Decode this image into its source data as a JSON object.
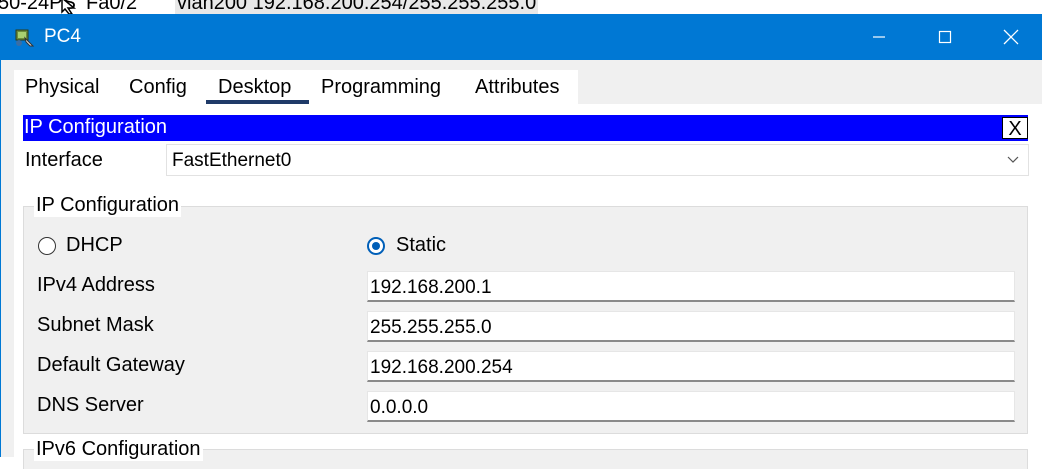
{
  "background": {
    "left_text": "50-24PS",
    "port_text": "Fa0/2",
    "vlan_text": "vlan200 192.168.200.254/255.255.255.0"
  },
  "window": {
    "title": "PC4",
    "icon": "pc-icon",
    "controls": {
      "minimize": "minimize-icon",
      "maximize": "maximize-icon",
      "close": "close-icon"
    }
  },
  "tabs": [
    {
      "label": "Physical"
    },
    {
      "label": "Config"
    },
    {
      "label": "Desktop",
      "active": true
    },
    {
      "label": "Programming"
    },
    {
      "label": "Attributes"
    }
  ],
  "ip_config": {
    "header_title": "IP Configuration",
    "close_label": "X",
    "interface_label": "Interface",
    "interface_value": "FastEthernet0",
    "group_title": "IP Configuration",
    "dhcp_label": "DHCP",
    "static_label": "Static",
    "mode_selected": "Static",
    "fields": [
      {
        "label": "IPv4 Address",
        "value": "192.168.200.1"
      },
      {
        "label": "Subnet Mask",
        "value": "255.255.255.0"
      },
      {
        "label": "Default Gateway",
        "value": "192.168.200.254"
      },
      {
        "label": "DNS Server",
        "value": "0.0.0.0"
      }
    ],
    "ipv6_group_title": "IPv6 Configuration"
  },
  "colors": {
    "titlebar": "#0078d4",
    "header_blue": "#0000ff",
    "radio_selected": "#005fb8",
    "active_tab_underline": "#1f3a68"
  }
}
